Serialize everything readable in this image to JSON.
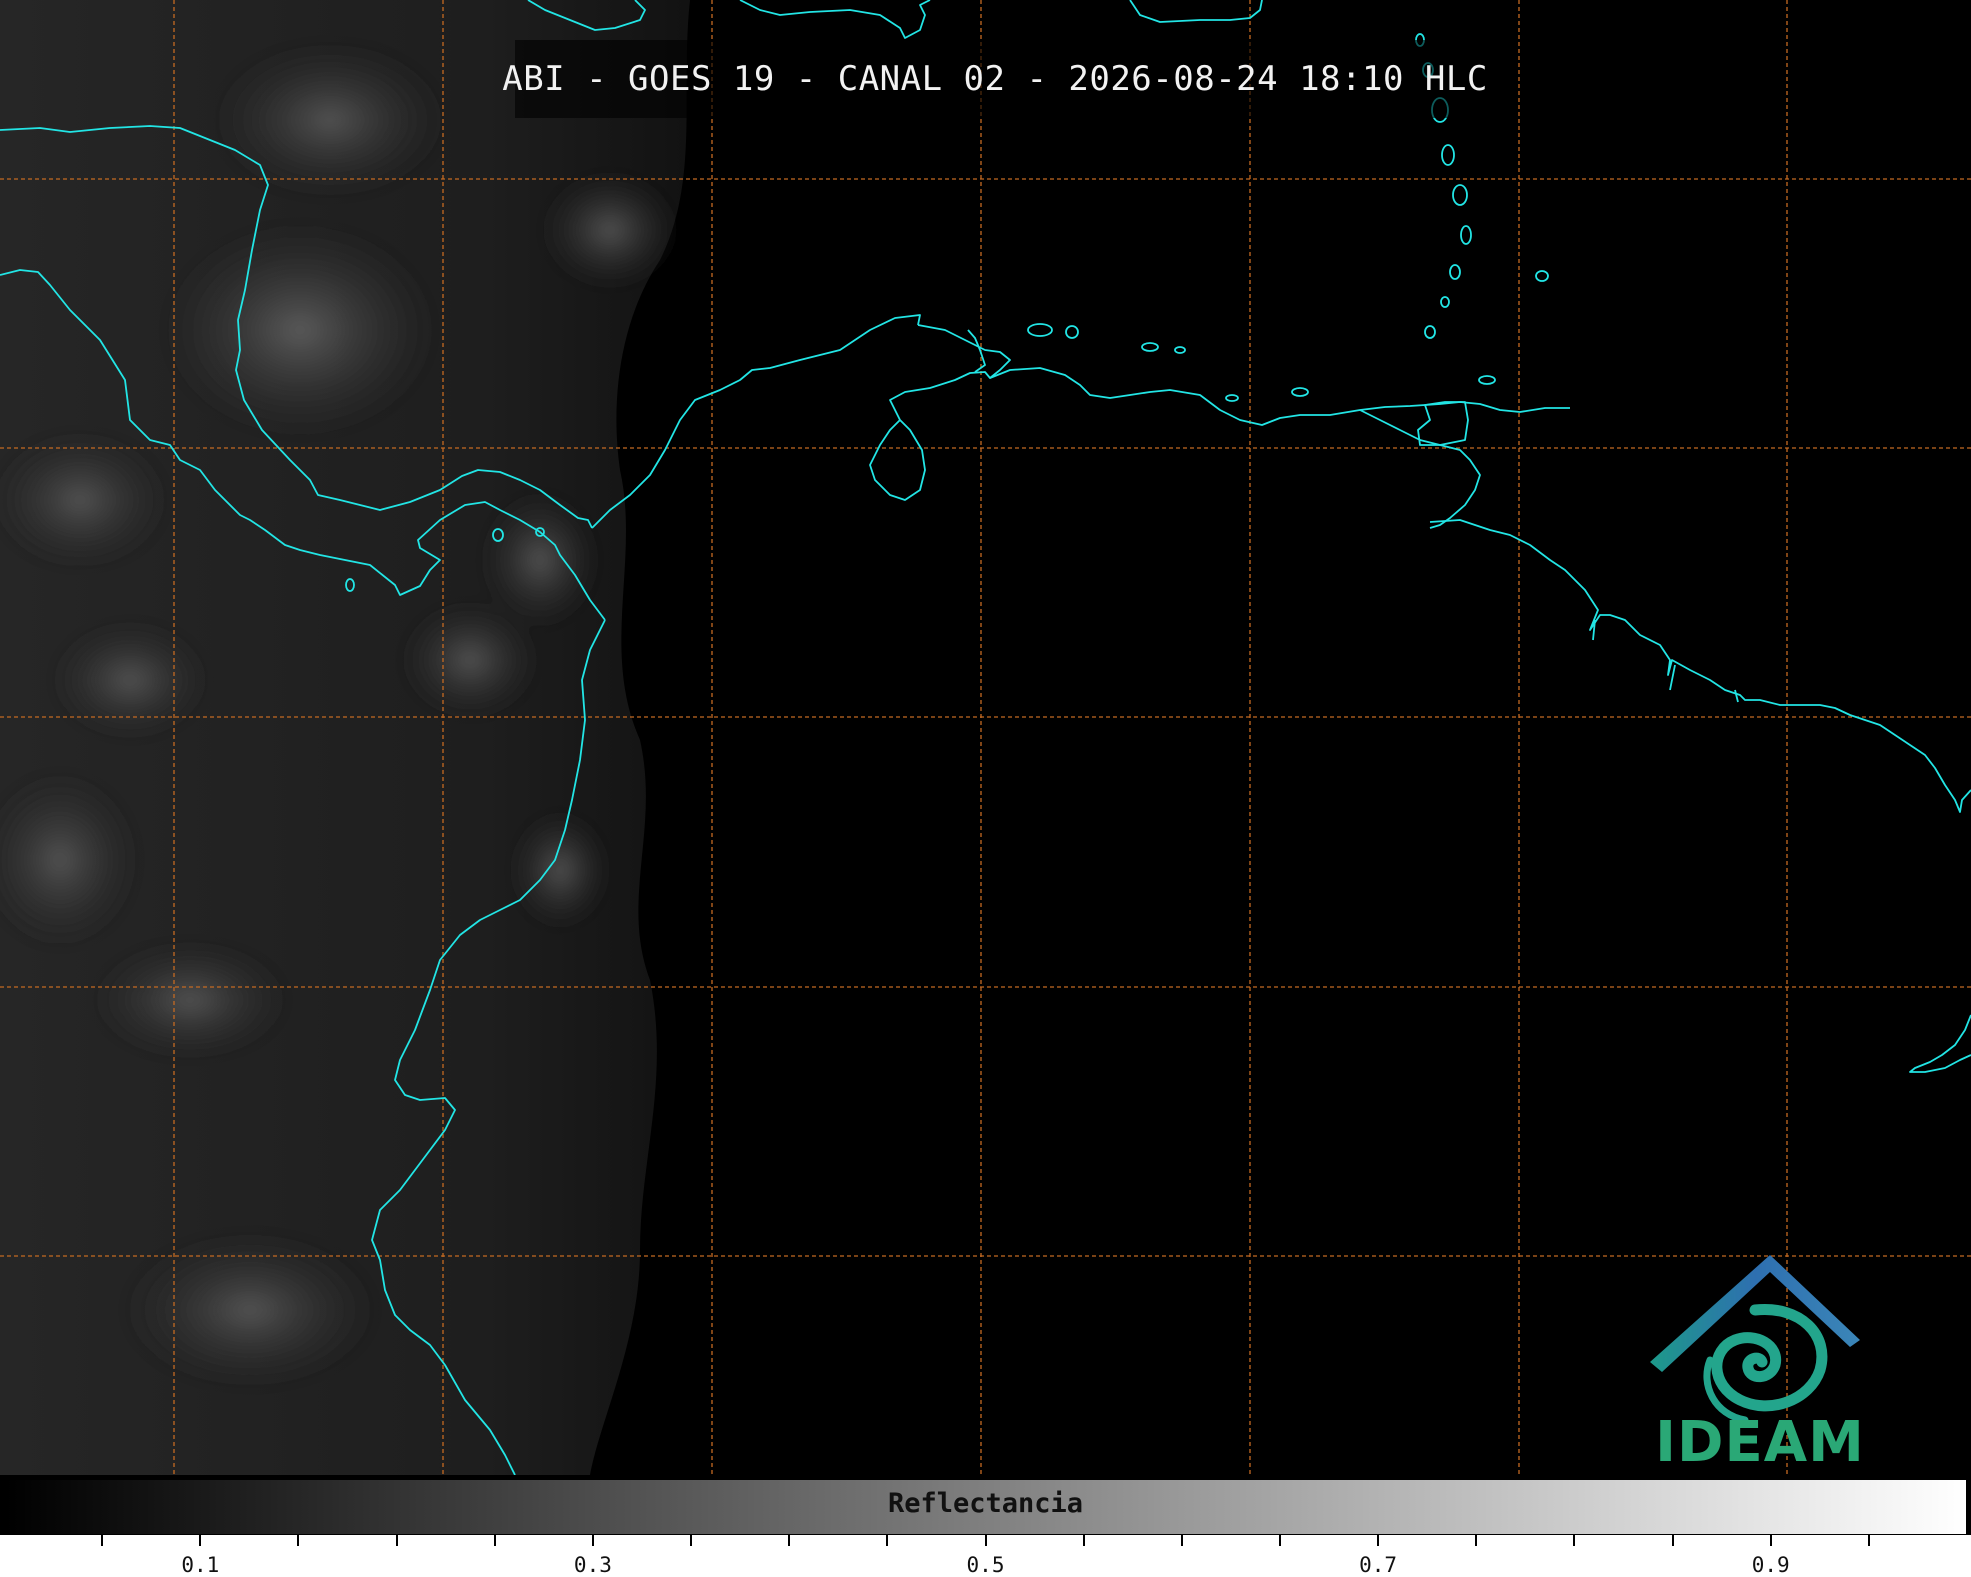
{
  "header": {
    "title": "ABI - GOES 19 - CANAL 02 - 2026-08-24 18:10 HLC"
  },
  "logo": {
    "name": "IDEAM",
    "icon": "ideam-logo-icon",
    "colors": {
      "roof": "#2e6fb0",
      "swirl": "#23a58c",
      "text": "#2aa876"
    }
  },
  "colorbar": {
    "label": "Reflectancia",
    "range": [
      0.0,
      1.0
    ],
    "tick_labels": [
      "0.1",
      "0.3",
      "0.5",
      "0.7",
      "0.9"
    ],
    "tick_values": [
      0.1,
      0.3,
      0.5,
      0.7,
      0.9
    ],
    "minor_step": 0.05,
    "colors": {
      "low": "#000000",
      "high": "#ffffff"
    }
  },
  "map": {
    "coastline_color": "#22e5e5",
    "grid_color": "#c46a22",
    "background_color": "#000000"
  }
}
